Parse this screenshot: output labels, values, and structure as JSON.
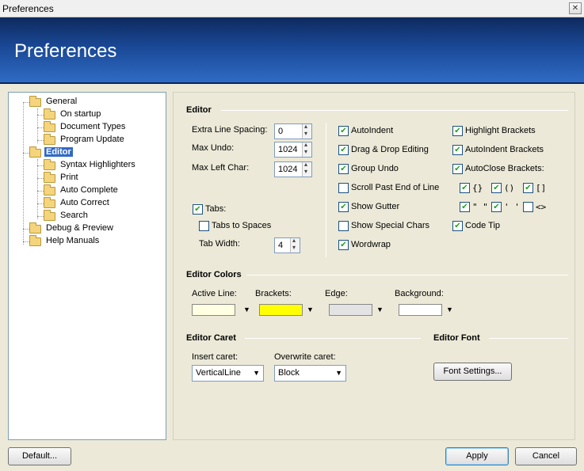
{
  "window": {
    "title": "Preferences"
  },
  "banner": {
    "title": "Preferences"
  },
  "tree": {
    "items": [
      {
        "label": "General"
      },
      {
        "label": "On startup"
      },
      {
        "label": "Document Types"
      },
      {
        "label": "Program Update"
      },
      {
        "label": "Editor"
      },
      {
        "label": "Syntax Highlighters"
      },
      {
        "label": "Print"
      },
      {
        "label": "Auto Complete"
      },
      {
        "label": "Auto Correct"
      },
      {
        "label": "Search"
      },
      {
        "label": "Debug & Preview"
      },
      {
        "label": "Help Manuals"
      }
    ],
    "selected": "Editor"
  },
  "editor": {
    "section": "Editor",
    "extra_line_spacing": {
      "label": "Extra Line Spacing:",
      "value": "0"
    },
    "max_undo": {
      "label": "Max Undo:",
      "value": "1024"
    },
    "max_left_char": {
      "label": "Max Left Char:",
      "value": "1024"
    },
    "tabs": {
      "label": "Tabs:",
      "checked": true
    },
    "tabs_to_spaces": {
      "label": "Tabs to Spaces",
      "checked": false
    },
    "tab_width": {
      "label": "Tab Width:",
      "value": "4"
    },
    "options_col1": [
      {
        "label": "AutoIndent",
        "checked": true
      },
      {
        "label": "Drag & Drop Editing",
        "checked": true
      },
      {
        "label": "Group Undo",
        "checked": true
      },
      {
        "label": "Scroll Past End of Line",
        "checked": false
      },
      {
        "label": "Show Gutter",
        "checked": true
      },
      {
        "label": "Show Special Chars",
        "checked": false
      },
      {
        "label": "Wordwrap",
        "checked": true
      }
    ],
    "options_col2": [
      {
        "label": "Highlight Brackets",
        "checked": true
      },
      {
        "label": "AutoIndent Brackets",
        "checked": true
      },
      {
        "label": "AutoClose Brackets:",
        "checked": true
      },
      {
        "label": "Code Tip",
        "checked": true
      }
    ],
    "bracket_pairs": [
      {
        "glyph": "{}",
        "checked": true
      },
      {
        "glyph": "()",
        "checked": true
      },
      {
        "glyph": "[]",
        "checked": true
      },
      {
        "glyph": "\" \"",
        "checked": true
      },
      {
        "glyph": "' '",
        "checked": true
      },
      {
        "glyph": "<>",
        "checked": false
      }
    ]
  },
  "colors": {
    "section": "Editor Colors",
    "items": [
      {
        "label": "Active Line:",
        "color": "#ffffe1"
      },
      {
        "label": "Brackets:",
        "color": "#ffff00"
      },
      {
        "label": "Edge:",
        "color": "#e3e3e3"
      },
      {
        "label": "Background:",
        "color": "#ffffff"
      }
    ]
  },
  "caret": {
    "section": "Editor Caret",
    "insert": {
      "label": "Insert caret:",
      "value": "VerticalLine"
    },
    "overwrite": {
      "label": "Overwrite caret:",
      "value": "Block"
    }
  },
  "font": {
    "section": "Editor Font",
    "button": "Font Settings..."
  },
  "footer": {
    "default": "Default...",
    "apply": "Apply",
    "cancel": "Cancel"
  }
}
